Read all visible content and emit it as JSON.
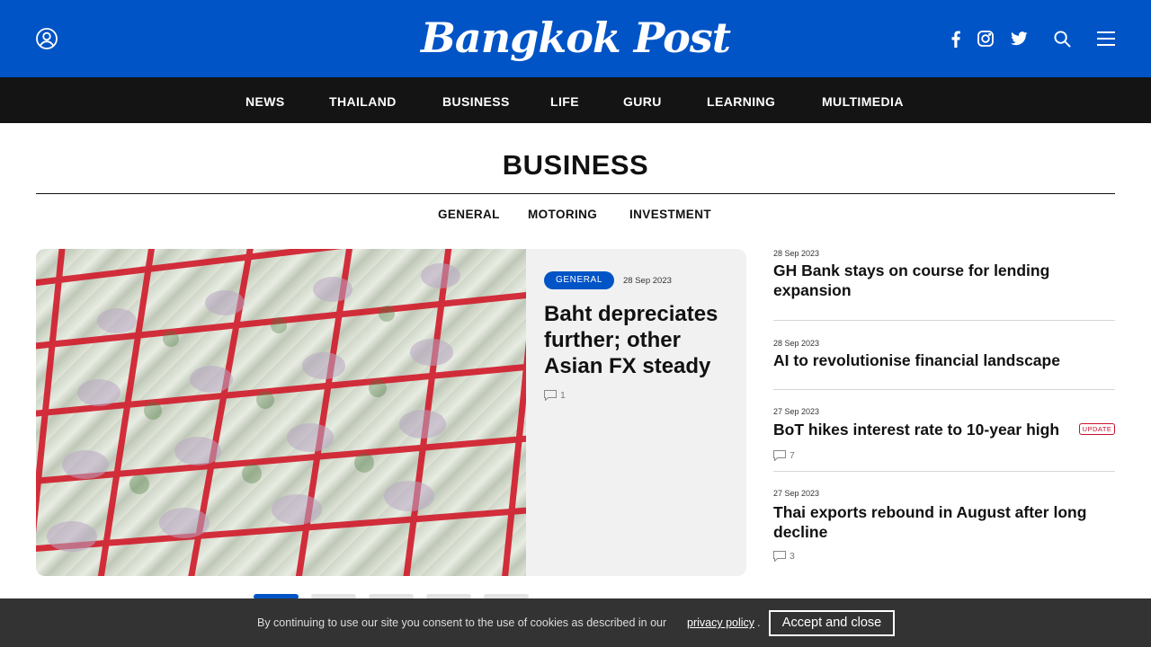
{
  "header": {
    "logo_text": "Bangkok Post",
    "brand_color": "#0054c6",
    "icons": [
      "user-icon",
      "facebook-icon",
      "instagram-icon",
      "twitter-icon",
      "search-icon",
      "menu-icon"
    ]
  },
  "nav": {
    "items": [
      "NEWS",
      "THAILAND",
      "BUSINESS",
      "LIFE",
      "GURU",
      "LEARNING",
      "MULTIMEDIA"
    ]
  },
  "section": {
    "title": "BUSINESS",
    "subnav": [
      "GENERAL",
      "MOTORING",
      "INVESTMENT"
    ]
  },
  "hero": {
    "category": "GENERAL",
    "date": "28 Sep 2023",
    "title": "Baht depreciates further; other Asian FX steady",
    "comments": "1"
  },
  "side_articles": [
    {
      "date": "28 Sep 2023",
      "title": "GH Bank stays on course for lending expansion"
    },
    {
      "date": "28 Sep 2023",
      "title": "AI to revolutionise financial landscape"
    },
    {
      "date": "27 Sep 2023",
      "title": "BoT hikes interest rate to 10-year high",
      "badge": "UPDATE",
      "comments": "7"
    },
    {
      "date": "27 Sep 2023",
      "title": "Thai exports rebound in August after long decline",
      "comments": "3"
    }
  ],
  "carousel": {
    "total": 5,
    "active": 1
  },
  "cookie": {
    "text": "By continuing to use our site you consent to the use of cookies as described in our",
    "link": "privacy policy",
    "period": ".",
    "button": "Accept and close"
  },
  "colors": {
    "update": "#c8102e",
    "nav_bg": "#141414",
    "cookie_bg": "#333333"
  }
}
